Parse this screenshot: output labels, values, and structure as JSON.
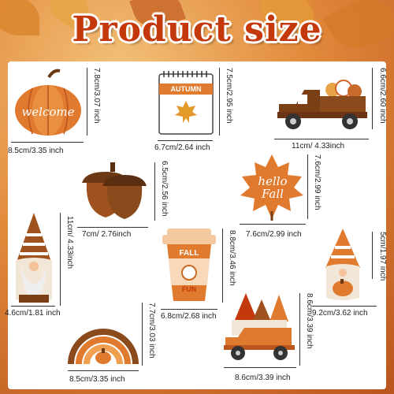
{
  "title": "Product size",
  "items": [
    {
      "name": "Pumpkin welcome",
      "text": "welcome",
      "width": "8.5cm/3.35 inch",
      "height": "7.8cm/3.07 inch"
    },
    {
      "name": "Autumn calendar",
      "text": "AUTUMN",
      "width": "6.7cm/2.64 inch",
      "height": "7.5cm/2.95 inch"
    },
    {
      "name": "Truck",
      "width": "11cm/ 4.33inch",
      "height": "6.6cm/2.60 inch"
    },
    {
      "name": "Acorn",
      "width": "7cm/ 2.76inch",
      "height": "6.5cm/2.56 inch"
    },
    {
      "name": "Hello fall leaf",
      "text": "hello Fall",
      "width": "7.6cm/2.99 inch",
      "height": "7.6cm/2.99 inch"
    },
    {
      "name": "Gnome left",
      "width": "4.6cm/1.81 inch",
      "height": "11cm/ 4.33inch"
    },
    {
      "name": "Fall fun cup",
      "text1": "FALL",
      "text2": "FUN",
      "width": "6.8cm/2.68 inch",
      "height": "8.8cm/3.46 inch"
    },
    {
      "name": "Gnome right",
      "width": "9.2cm/3.62 inch",
      "height": "5cm/1.97 inch"
    },
    {
      "name": "Rainbow",
      "width": "8.5cm/3.35 inch",
      "height": "7.7cm/3.03 inch"
    },
    {
      "name": "Gnome truck",
      "width": "8.6cm/3.39 inch",
      "height": "8.6cm/3.39 inch"
    }
  ],
  "colors": {
    "accent": "#c4390c",
    "orange": "#e07a2e",
    "brown": "#7b3f16"
  }
}
